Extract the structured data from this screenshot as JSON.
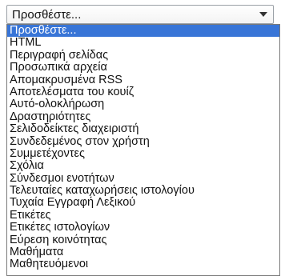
{
  "select": {
    "value": "Προσθέστε...",
    "arrow_icon": "chevron-down-icon"
  },
  "options": [
    "Προσθέστε...",
    "HTML",
    "Περιγραφή σελίδας",
    "Προσωπικά αρχεία",
    "Απομακρυσμένα RSS",
    "Αποτελέσματα του κουίζ",
    "Αυτό-ολοκλήρωση",
    "Δραστηριότητες",
    "Σελιδοδείκτες διαχειριστή",
    "Συνδεδεμένος στον χρήστη",
    "Συμμετέχοντες",
    "Σχόλια",
    "Σύνδεσμοι ενοτήτων",
    "Τελευταίες καταχωρήσεις ιστολογίου",
    "Τυχαία Εγγραφή Λεξικού",
    "Ετικέτες",
    "Ετικέτες ιστολογίων",
    "Εύρεση κοινότητας",
    "Μαθήματα",
    "Μαθητευόμενοι"
  ],
  "selected_index": 0,
  "colors": {
    "highlight": "#3875d7",
    "border": "#7a7a7a"
  }
}
